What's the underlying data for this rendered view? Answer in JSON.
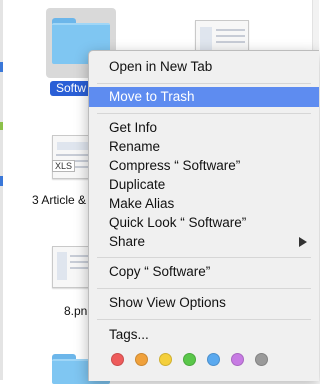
{
  "files": {
    "folder_top_label": "Softw",
    "xls_badge": "XLS",
    "article_label": "3 Article &",
    "png_label": "8.pn"
  },
  "menu": {
    "items": [
      {
        "label": "Open in New Tab"
      },
      {
        "label": "Move to Trash",
        "highlighted": true
      },
      {
        "label": "Get Info"
      },
      {
        "label": "Rename"
      },
      {
        "label": "Compress “ Software”"
      },
      {
        "label": "Duplicate"
      },
      {
        "label": "Make Alias"
      },
      {
        "label": "Quick Look “ Software”"
      },
      {
        "label": "Share"
      },
      {
        "label": "Copy “ Software”"
      },
      {
        "label": "Show View Options"
      },
      {
        "label": "Tags..."
      }
    ],
    "tag_colors": [
      "#ee5b5b",
      "#f0a13b",
      "#f4cf3b",
      "#5ac74a",
      "#5aa9ef",
      "#c77be3",
      "#9a9a9a"
    ]
  },
  "colors": {
    "highlight": "#5e8cf0",
    "selection": "#2a5fd6",
    "folder": "#7fc6f2"
  }
}
